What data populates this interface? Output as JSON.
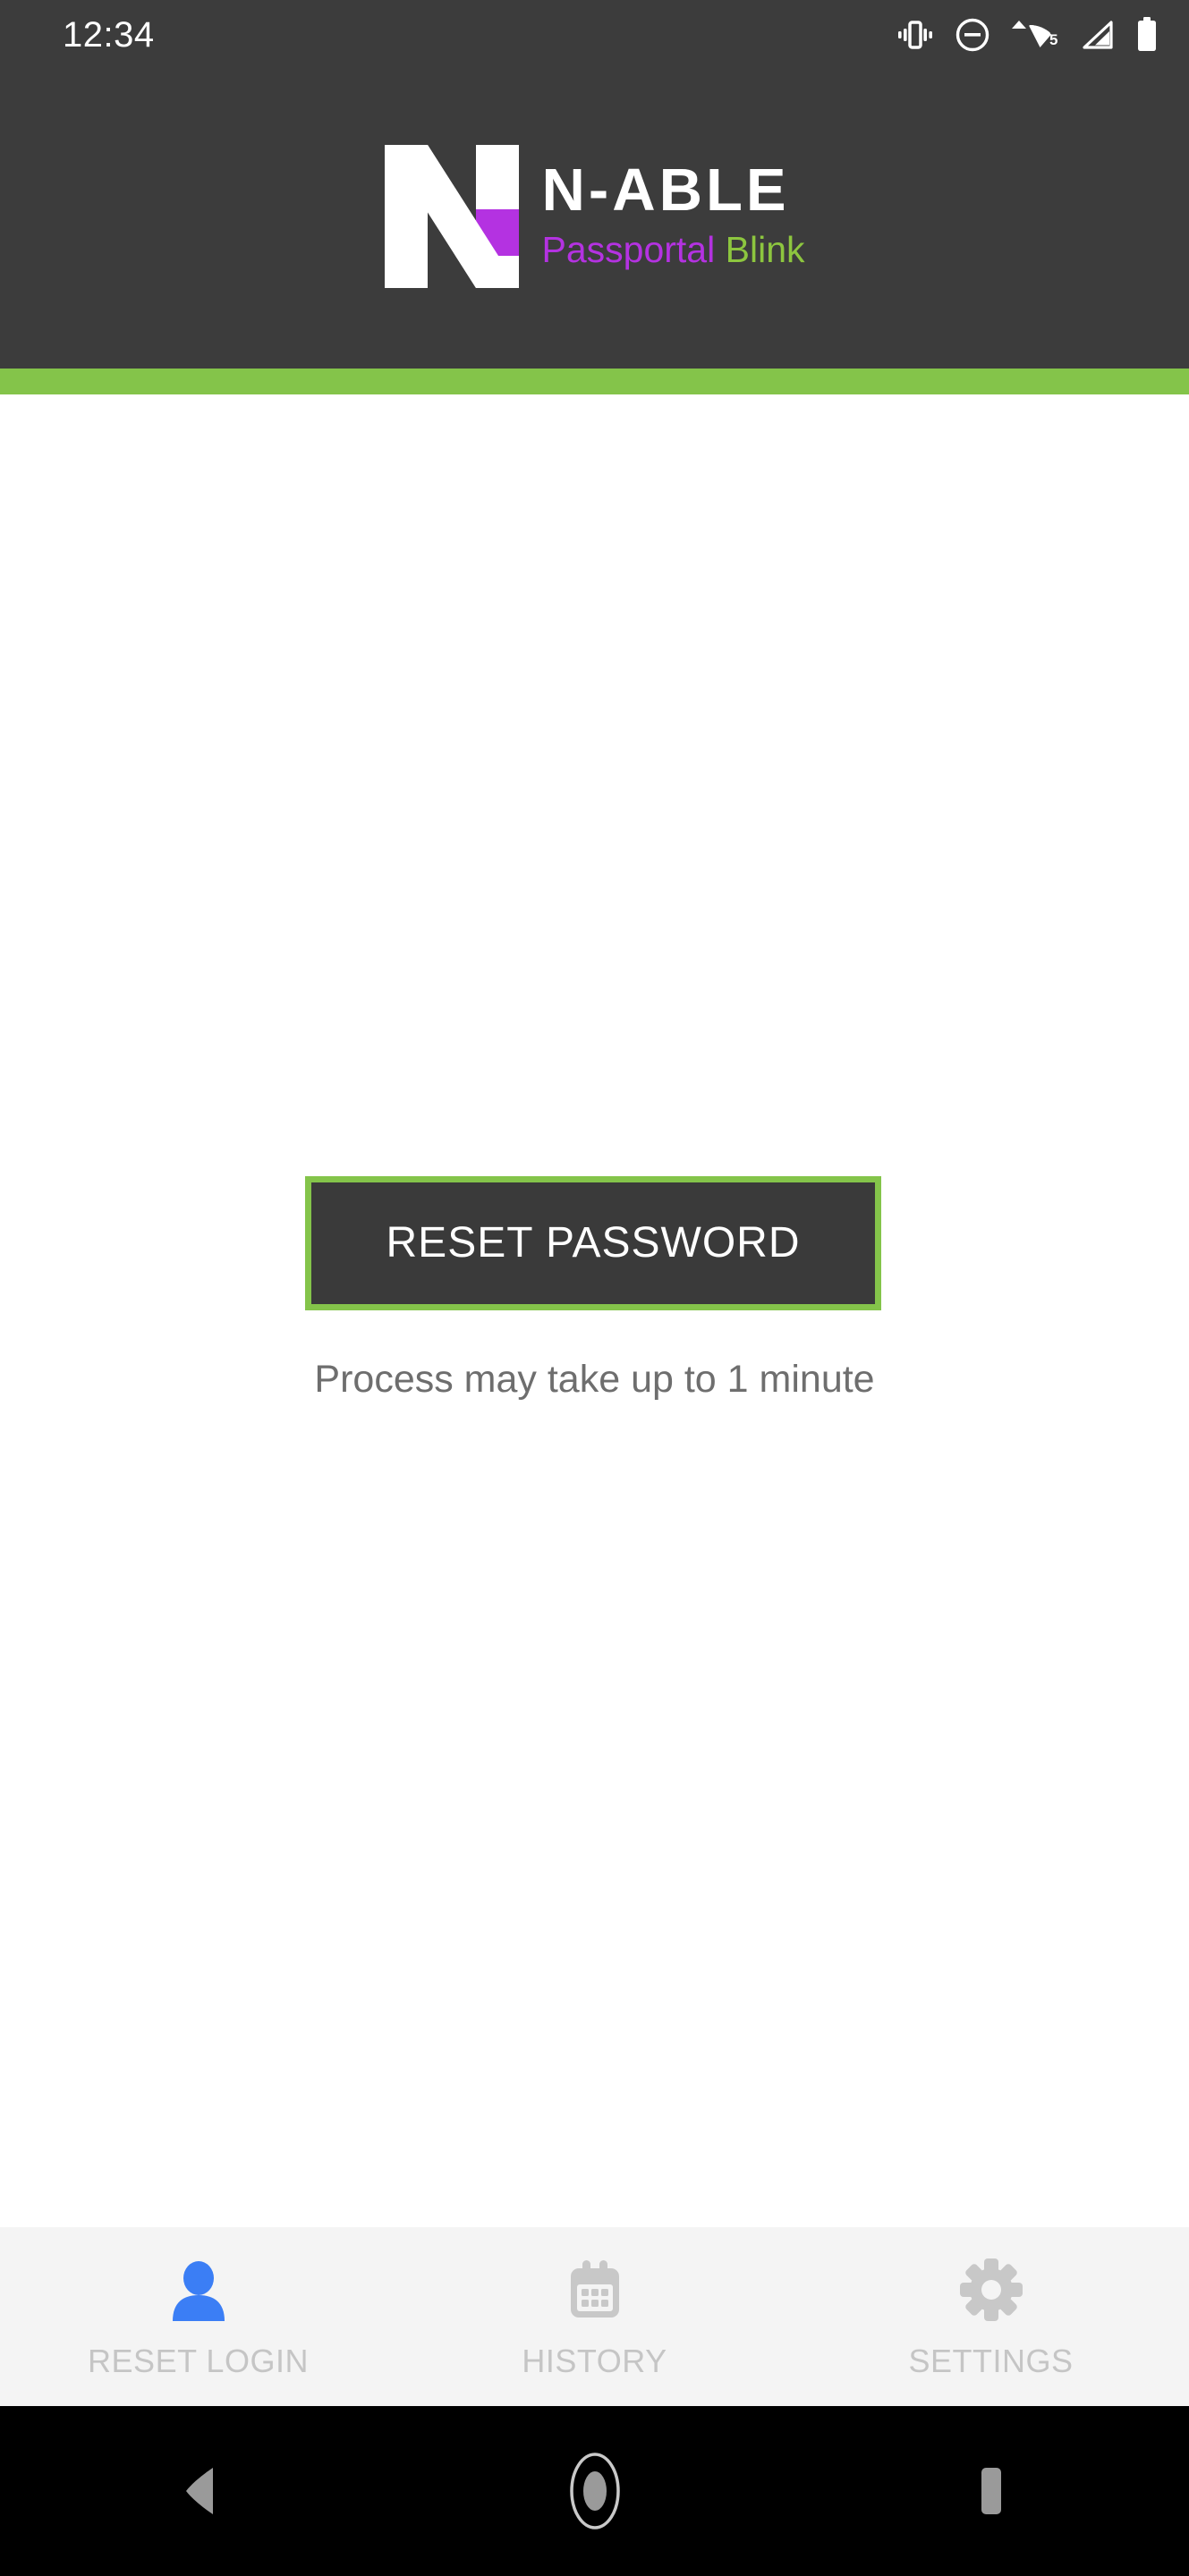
{
  "status_bar": {
    "clock": "12:34",
    "icons": [
      {
        "name": "vibrate-icon",
        "label": "Vibrate"
      },
      {
        "name": "do-not-disturb-icon",
        "label": "Do Not Disturb"
      },
      {
        "name": "wifi-icon",
        "label": "Wi-Fi",
        "badge": "5"
      },
      {
        "name": "cellular-signal-icon",
        "label": "Cellular signal"
      },
      {
        "name": "battery-icon",
        "label": "Battery"
      }
    ],
    "background_color": "#3c3c3c",
    "foreground_color": "#ffffff"
  },
  "header": {
    "logo_name": "n-able-logo",
    "title": "N-ABLE",
    "subtitle_primary": "Passportal",
    "subtitle_secondary": "Blink",
    "subtitle_primary_color": "#b432e1",
    "subtitle_secondary_color": "#8dc63f",
    "background_color": "#3c3c3c",
    "title_color": "#ffffff",
    "logo_mark_color": "#ffffff",
    "logo_accent_color": "#b432e1"
  },
  "accent_bar": {
    "color": "#84c44a"
  },
  "main": {
    "reset_button_label": "RESET PASSWORD",
    "reset_button_background": "#3a3a3a",
    "reset_button_border_color": "#84c44a",
    "reset_button_text_color": "#ffffff",
    "hint_text": "Process may take up to 1 minute",
    "hint_text_color": "#6e6e6e",
    "background_color": "#ffffff"
  },
  "bottom_nav": {
    "background_color": "#f4f4f4",
    "active_icon_color": "#3b7ef5",
    "inactive_icon_color": "#c8c8c8",
    "label_color": "#c5c5c5",
    "items": [
      {
        "label": "RESET LOGIN",
        "icon": "person-icon",
        "active": true
      },
      {
        "label": "HISTORY",
        "icon": "calendar-icon",
        "active": false
      },
      {
        "label": "SETTINGS",
        "icon": "gear-icon",
        "active": false
      }
    ]
  },
  "system_nav": {
    "background_color": "#000000",
    "icon_color": "#9a9a9a",
    "buttons": [
      {
        "label": "Back",
        "icon": "back-triangle-icon"
      },
      {
        "label": "Home",
        "icon": "home-circle-icon"
      },
      {
        "label": "Recents",
        "icon": "recents-square-icon"
      }
    ]
  }
}
